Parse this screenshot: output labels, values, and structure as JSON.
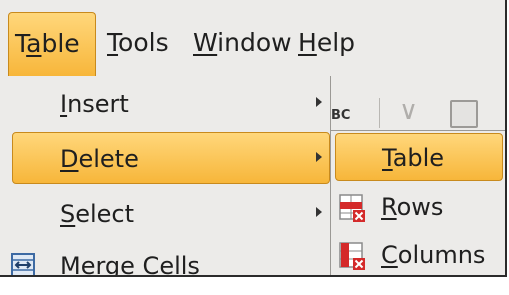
{
  "menubar": {
    "items": [
      {
        "pre": "T",
        "u": "a",
        "post": "ble"
      },
      {
        "pre": "",
        "u": "T",
        "post": "ools"
      },
      {
        "pre": "",
        "u": "W",
        "post": "indow"
      },
      {
        "pre": "",
        "u": "H",
        "post": "elp"
      }
    ],
    "active_index": 0
  },
  "toolbar": {
    "spellcheck_text": "BC",
    "glyph_text": "∨"
  },
  "table_menu": {
    "items": [
      {
        "u": "I",
        "post": "nsert",
        "icon": "none",
        "submenu": true,
        "highlighted": false
      },
      {
        "u": "D",
        "post": "elete",
        "icon": "none",
        "submenu": true,
        "highlighted": true
      },
      {
        "u": "S",
        "post": "elect",
        "icon": "none",
        "submenu": true,
        "highlighted": false
      },
      {
        "u": "M",
        "post": "erge Cells",
        "icon": "merge-cells-icon",
        "submenu": false,
        "highlighted": false
      }
    ]
  },
  "delete_submenu": {
    "items": [
      {
        "u": "T",
        "post": "able",
        "icon": "none",
        "highlighted": true
      },
      {
        "u": "R",
        "post": "ows",
        "icon": "delete-rows-icon",
        "highlighted": false
      },
      {
        "u": "C",
        "post": "olumns",
        "icon": "delete-columns-icon",
        "highlighted": false
      }
    ]
  },
  "colors": {
    "highlight_top": "#ffd77b",
    "highlight_bottom": "#f7b63a",
    "highlight_border": "#c88a1d",
    "menu_bg": "#ecebe9",
    "delete_red": "#d42a2a"
  }
}
